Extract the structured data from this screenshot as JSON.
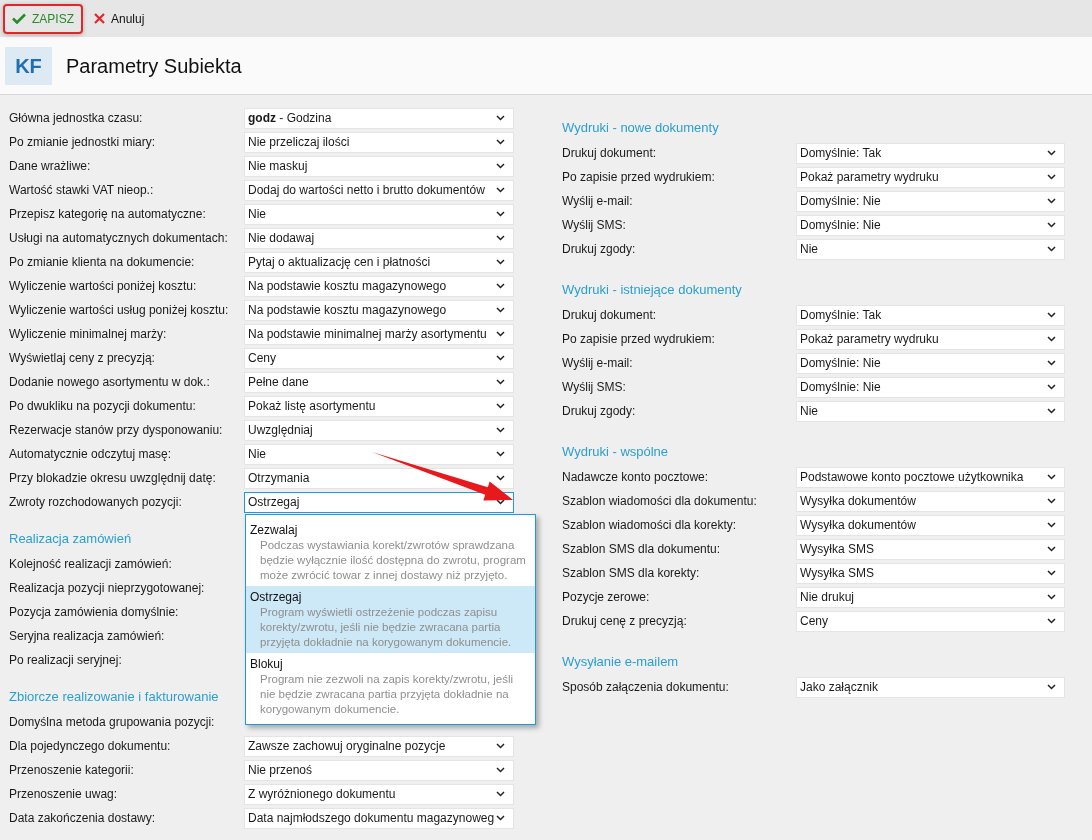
{
  "toolbar": {
    "buttons": [
      {
        "kind": "save",
        "label": "ZAPISZ",
        "highlighted": true
      },
      {
        "kind": "cancel",
        "label": "Anuluj",
        "highlighted": false
      }
    ]
  },
  "header": {
    "badge": "KF",
    "title": "Parametry Subiekta"
  },
  "left_column": [
    {
      "rows": [
        {
          "label": "Główna jednostka czasu:",
          "value": "**godz** - Godzina",
          "focused": false
        },
        {
          "label": "Po zmianie jednostki miary:",
          "value": "Nie przeliczaj ilości",
          "focused": false
        },
        {
          "label": "Dane wrażliwe:",
          "value": "Nie maskuj",
          "focused": false
        },
        {
          "label": "Wartość stawki VAT nieop.:",
          "value": "Dodaj do wartości netto i brutto dokumentów",
          "focused": false
        },
        {
          "label": "Przepisz kategorię na automatyczne:",
          "value": "Nie",
          "focused": false
        },
        {
          "label": "Usługi na automatycznych dokumentach:",
          "value": "Nie dodawaj",
          "focused": false
        },
        {
          "label": "Po zmianie klienta na dokumencie:",
          "value": "Pytaj o aktualizację cen i płatności",
          "focused": false
        },
        {
          "label": "Wyliczenie wartości poniżej kosztu:",
          "value": "Na podstawie kosztu magazynowego",
          "focused": false
        },
        {
          "label": "Wyliczenie wartości usług poniżej kosztu:",
          "value": "Na podstawie kosztu magazynowego",
          "focused": false
        },
        {
          "label": "Wyliczenie minimalnej marży:",
          "value": "Na podstawie minimalnej marży asortymentu",
          "focused": false
        },
        {
          "label": "Wyświetlaj ceny z precyzją:",
          "value": "Ceny",
          "focused": false
        },
        {
          "label": "Dodanie nowego asortymentu w dok.:",
          "value": "Pełne dane",
          "focused": false
        },
        {
          "label": "Po dwukliku na pozycji dokumentu:",
          "value": "Pokaż listę asortymentu",
          "focused": false
        },
        {
          "label": "Rezerwacje stanów przy dysponowaniu:",
          "value": "Uwzględniaj",
          "focused": false
        },
        {
          "label": "Automatycznie odczytuj masę:",
          "value": "Nie",
          "focused": false
        },
        {
          "label": "Przy blokadzie okresu uwzględnij datę:",
          "value": "Otrzymania",
          "focused": false
        },
        {
          "label": "Zwroty rozchodowanych pozycji:",
          "value": "Ostrzegaj",
          "focused": true
        }
      ]
    },
    {
      "heading": "Realizacja zamówień",
      "rows": [
        {
          "label": "Kolejność realizacji zamówień:"
        },
        {
          "label": "Realizacja pozycji nieprzygotowanej:"
        },
        {
          "label": "Pozycja zamówienia domyślnie:"
        },
        {
          "label": "Seryjna realizacja zamówień:"
        },
        {
          "label": "Po realizacji seryjnej:"
        }
      ]
    },
    {
      "heading": "Zbiorcze realizowanie i fakturowanie",
      "rows": [
        {
          "label": "Domyślna metoda grupowania pozycji:"
        },
        {
          "label": "Dla pojedynczego dokumentu:",
          "value": "Zawsze zachowuj oryginalne pozycje",
          "focused": false
        },
        {
          "label": "Przenoszenie kategorii:",
          "value": "Nie przenoś",
          "focused": false
        },
        {
          "label": "Przenoszenie uwag:",
          "value": "Z wyróżnionego dokumentu",
          "focused": false
        },
        {
          "label": "Data zakończenia dostawy:",
          "value": "Data najmłodszego dokumentu magazynoweg",
          "focused": false
        }
      ]
    }
  ],
  "right_column": [
    {
      "heading": "Wydruki - nowe dokumenty",
      "rows": [
        {
          "label": "Drukuj dokument:",
          "value": "Domyślnie: Tak",
          "focused": false
        },
        {
          "label": "Po zapisie przed wydrukiem:",
          "value": "Pokaż parametry wydruku",
          "focused": false
        },
        {
          "label": "Wyślij e-mail:",
          "value": "Domyślnie: Nie",
          "focused": false
        },
        {
          "label": "Wyślij SMS:",
          "value": "Domyślnie: Nie",
          "focused": false
        },
        {
          "label": "Drukuj zgody:",
          "value": "Nie",
          "focused": false
        }
      ]
    },
    {
      "heading": "Wydruki - istniejące dokumenty",
      "rows": [
        {
          "label": "Drukuj dokument:",
          "value": "Domyślnie: Tak",
          "focused": false
        },
        {
          "label": "Po zapisie przed wydrukiem:",
          "value": "Pokaż parametry wydruku",
          "focused": false
        },
        {
          "label": "Wyślij e-mail:",
          "value": "Domyślnie: Nie",
          "focused": false
        },
        {
          "label": "Wyślij SMS:",
          "value": "Domyślnie: Nie",
          "focused": false
        },
        {
          "label": "Drukuj zgody:",
          "value": "Nie",
          "focused": false
        }
      ]
    },
    {
      "heading": "Wydruki - wspólne",
      "rows": [
        {
          "label": "Nadawcze konto pocztowe:",
          "value": "Podstawowe konto pocztowe użytkownika",
          "focused": false
        },
        {
          "label": "Szablon wiadomości dla dokumentu:",
          "value": "Wysyłka dokumentów",
          "focused": false
        },
        {
          "label": "Szablon wiadomości dla korekty:",
          "value": "Wysyłka dokumentów",
          "focused": false
        },
        {
          "label": "Szablon SMS dla dokumentu:",
          "value": "Wysyłka SMS",
          "focused": false
        },
        {
          "label": "Szablon SMS dla korekty:",
          "value": "Wysyłka SMS",
          "focused": false
        },
        {
          "label": "Pozycje zerowe:",
          "value": "Nie drukuj",
          "focused": false
        },
        {
          "label": "Drukuj cenę z precyzją:",
          "value": "Ceny",
          "focused": false
        }
      ]
    },
    {
      "heading": "Wysyłanie e-mailem",
      "rows": [
        {
          "label": "Sposób załączenia dokumentu:",
          "value": "Jako załącznik",
          "focused": false
        }
      ]
    }
  ],
  "dropdown": {
    "options": [
      {
        "title": "Zezwalaj",
        "description": "Podczas wystawiania korekt/zwrotów sprawdzana będzie wyłącznie ilość dostępna do zwrotu, program może zwrócić towar z innej dostawy niż przyjęto.",
        "selected": false
      },
      {
        "title": "Ostrzegaj",
        "description": "Program wyświetli ostrzeżenie podczas zapisu korekty/zwrotu, jeśli nie będzie zwracana partia przyjęta dokładnie na korygowanym dokumencie.",
        "selected": true
      },
      {
        "title": "Blokuj",
        "description": "Program nie zezwoli na zapis korekty/zwrotu, jeśli nie będzie zwracana partia przyjęta dokładnie na korygowanym dokumencie.",
        "selected": false
      }
    ]
  }
}
